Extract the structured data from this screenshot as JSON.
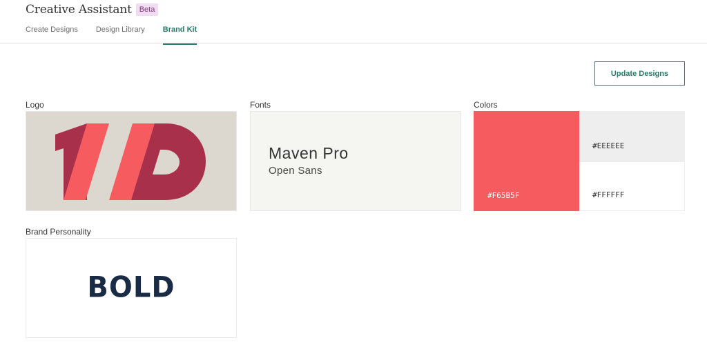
{
  "app": {
    "title": "Creative Assistant",
    "badge": "Beta"
  },
  "tabs": [
    {
      "label": "Create Designs",
      "active": false
    },
    {
      "label": "Design Library",
      "active": false
    },
    {
      "label": "Brand Kit",
      "active": true
    }
  ],
  "actions": {
    "update_label": "Update Designs"
  },
  "sections": {
    "logo": {
      "label": "Logo",
      "icon": "wd-logo-mark"
    },
    "fonts": {
      "label": "Fonts",
      "primary": "Maven Pro",
      "secondary": "Open Sans"
    },
    "colors": {
      "label": "Colors",
      "swatches": [
        {
          "hex": "#F65B5F",
          "text": "#F65B5F"
        },
        {
          "hex": "#EEEEEE",
          "text": "#EEEEEE"
        },
        {
          "hex": "#FFFFFF",
          "text": "#FFFFFF"
        }
      ]
    },
    "personality": {
      "label": "Brand Personality",
      "word": "BOLD"
    }
  },
  "theme": {
    "accent": "#2b7a6b",
    "logo_dark": "#a8304a",
    "logo_light": "#f65b5f",
    "logo_bg": "#dcd8cf"
  }
}
